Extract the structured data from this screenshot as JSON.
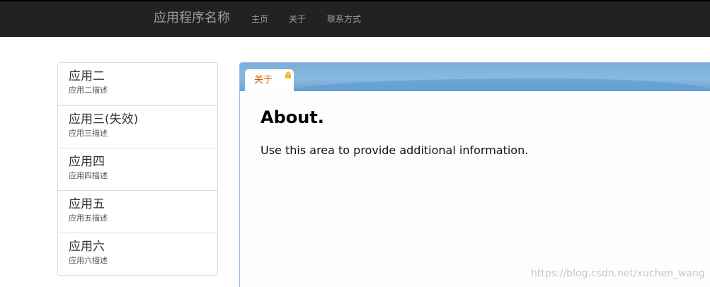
{
  "navbar": {
    "brand": "应用程序名称",
    "links": [
      "主页",
      "关于",
      "联系方式"
    ]
  },
  "sidebar": {
    "items": [
      {
        "title": "应用二",
        "desc": "应用二描述"
      },
      {
        "title": "应用三(失效)",
        "desc": "应用三描述"
      },
      {
        "title": "应用四",
        "desc": "应用四描述"
      },
      {
        "title": "应用五",
        "desc": "应用五描述"
      },
      {
        "title": "应用六",
        "desc": "应用六描述"
      }
    ]
  },
  "tab": {
    "label": "关于",
    "icon": "lock-icon"
  },
  "content": {
    "title": "About.",
    "text": "Use this area to provide additional information."
  },
  "watermark": "https://blog.csdn.net/xuchen_wang",
  "colors": {
    "navbar_bg": "#222222",
    "tab_label": "#cc5500",
    "tabbar": "#8ab9df"
  }
}
